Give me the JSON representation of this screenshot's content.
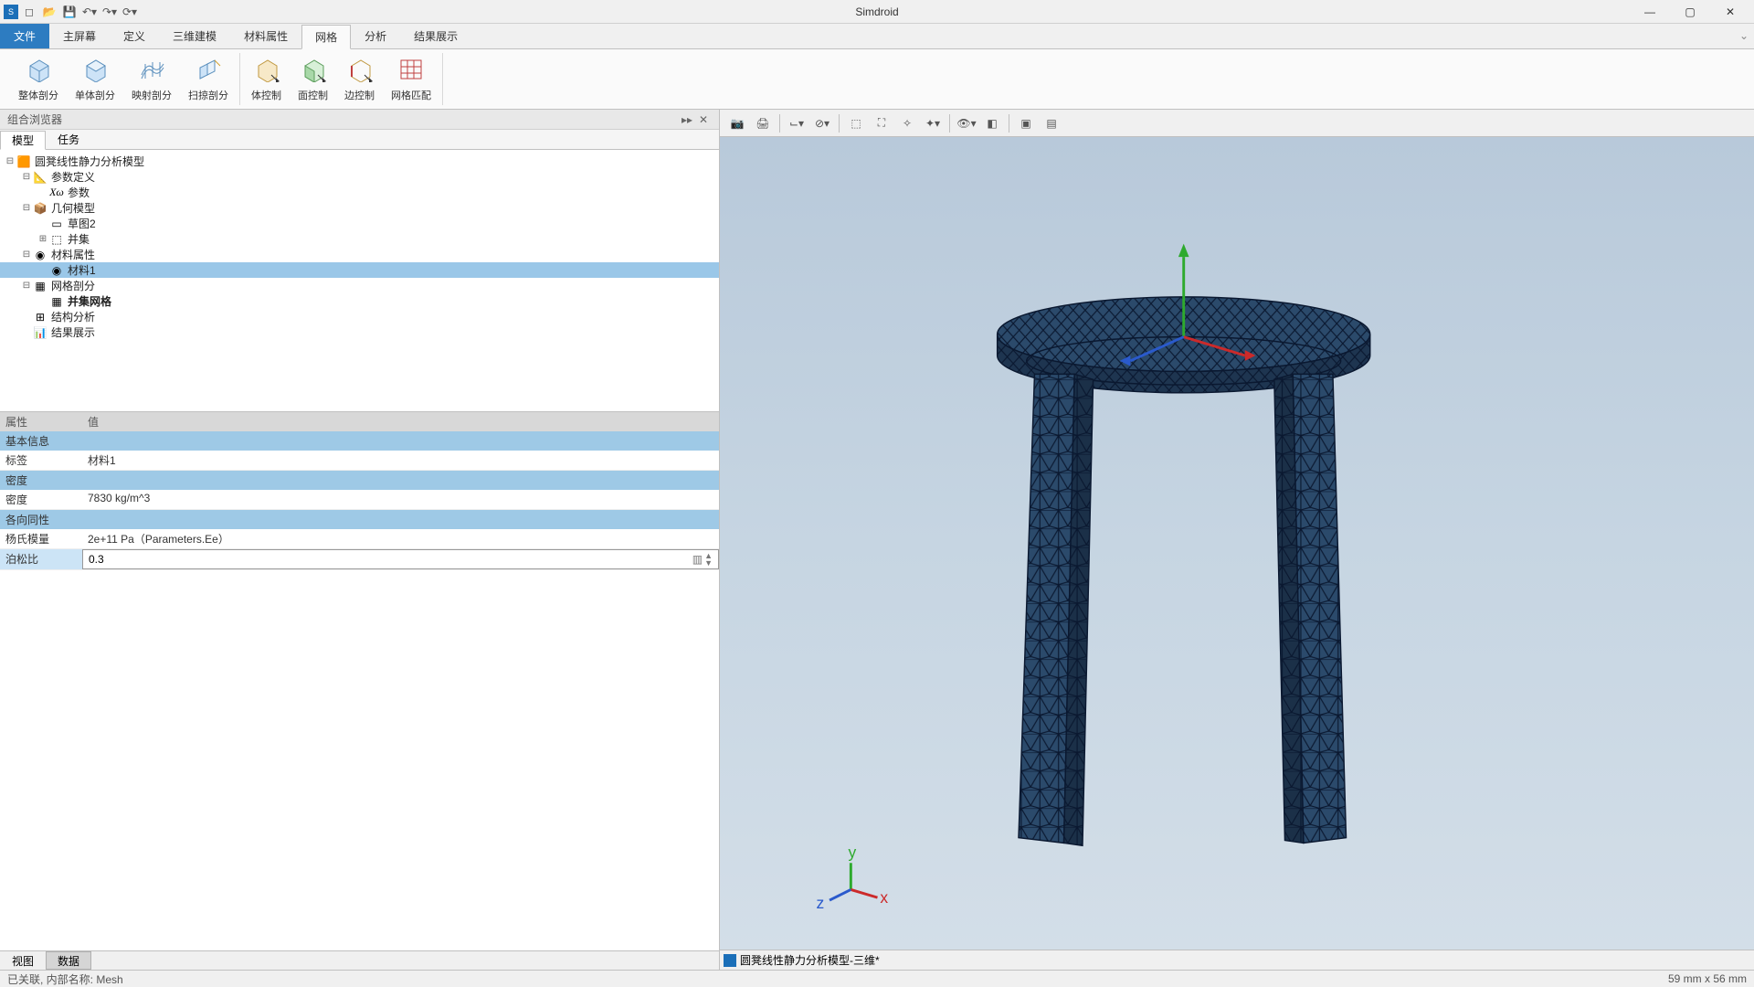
{
  "app": {
    "title": "Simdroid"
  },
  "qat": {
    "items": [
      "new-icon",
      "open-icon",
      "save-icon",
      "undo-icon",
      "redo-icon",
      "refresh-icon"
    ]
  },
  "menu": {
    "file": "文件",
    "items": [
      "主屏幕",
      "定义",
      "三维建模",
      "材料属性",
      "网格",
      "分析",
      "结果展示"
    ],
    "active_index": 4
  },
  "ribbon": {
    "groups": [
      {
        "buttons": [
          {
            "name": "global-mesh",
            "label": "整体剖分"
          },
          {
            "name": "single-mesh",
            "label": "单体剖分"
          },
          {
            "name": "map-mesh",
            "label": "映射剖分"
          },
          {
            "name": "sweep-mesh",
            "label": "扫掠剖分"
          }
        ]
      },
      {
        "buttons": [
          {
            "name": "body-ctrl",
            "label": "体控制"
          },
          {
            "name": "face-ctrl",
            "label": "面控制"
          },
          {
            "name": "edge-ctrl",
            "label": "边控制"
          },
          {
            "name": "mesh-match",
            "label": "网格匹配"
          }
        ]
      }
    ]
  },
  "browser": {
    "title": "组合浏览器",
    "tabs": [
      "模型",
      "任务"
    ],
    "active_tab": 0,
    "bottom_tabs": [
      "视图",
      "数据"
    ],
    "active_bottom": 1
  },
  "tree": {
    "root": "圆凳线性静力分析模型",
    "nodes": [
      {
        "depth": 0,
        "toggle": "-",
        "icon": "model",
        "label": "圆凳线性静力分析模型"
      },
      {
        "depth": 1,
        "toggle": "-",
        "icon": "param",
        "label": "参数定义"
      },
      {
        "depth": 2,
        "toggle": "",
        "icon": "xw",
        "label": "参数"
      },
      {
        "depth": 1,
        "toggle": "-",
        "icon": "geom",
        "label": "几何模型"
      },
      {
        "depth": 2,
        "toggle": "",
        "icon": "sketch",
        "label": "草图2"
      },
      {
        "depth": 2,
        "toggle": "+",
        "icon": "union",
        "label": "并集"
      },
      {
        "depth": 1,
        "toggle": "-",
        "icon": "mat",
        "label": "材料属性"
      },
      {
        "depth": 2,
        "toggle": "",
        "icon": "mat1",
        "label": "材料1",
        "selected": true
      },
      {
        "depth": 1,
        "toggle": "-",
        "icon": "mesh",
        "label": "网格剖分"
      },
      {
        "depth": 2,
        "toggle": "",
        "icon": "meshset",
        "label": "并集网格",
        "bold": true
      },
      {
        "depth": 1,
        "toggle": "",
        "icon": "struct",
        "label": "结构分析"
      },
      {
        "depth": 1,
        "toggle": "",
        "icon": "result",
        "label": "结果展示"
      }
    ]
  },
  "props": {
    "header": {
      "c1": "属性",
      "c2": "值"
    },
    "sections": [
      {
        "title": "基本信息",
        "rows": [
          {
            "k": "标签",
            "v": "材料1"
          }
        ]
      },
      {
        "title": "密度",
        "rows": [
          {
            "k": "密度",
            "v": "7830 kg/m^3"
          }
        ]
      },
      {
        "title": "各向同性",
        "rows": [
          {
            "k": "杨氏模量",
            "v": "2e+11 Pa（Parameters.Ee）"
          },
          {
            "k": "泊松比",
            "v": "0.3",
            "editing": true
          }
        ]
      }
    ]
  },
  "viewtab": {
    "label": "圆凳线性静力分析模型-三维*"
  },
  "status": {
    "left": "已关联, 内部名称: Mesh",
    "right": "59 mm x 56 mm"
  }
}
